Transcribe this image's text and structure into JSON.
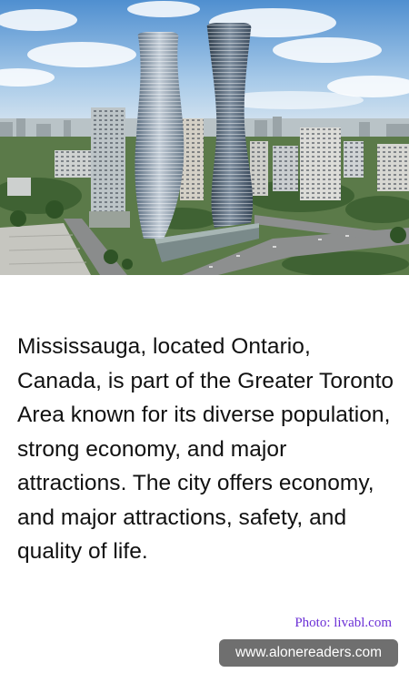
{
  "article": {
    "body": "Mississauga, located Ontario, Canada, is part of the Greater Toronto Area known for its diverse population, strong economy, and major attractions. The city offers economy, and major attractions, safety, and quality of life."
  },
  "photo_credit": "Photo: livabl.com",
  "site_badge": "www.alonereaders.com",
  "colors": {
    "credit": "#6b2fd6",
    "badge_bg": "#6f6f6f",
    "text": "#111111"
  }
}
